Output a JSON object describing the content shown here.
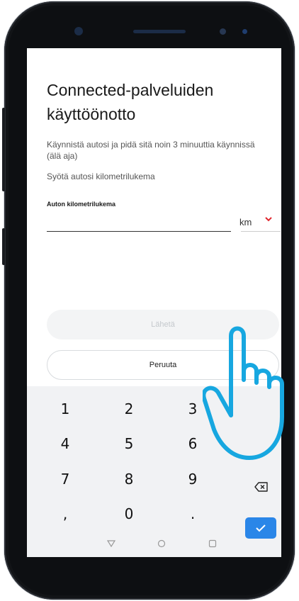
{
  "screen": {
    "title": "Connected-palveluiden käyttöönotto",
    "instruction_1": "Käynnistä autosi ja pidä sitä noin 3 minuuttia käynnissä (älä aja)",
    "instruction_2": "Syötä autosi kilometrilukema",
    "field_label": "Auton kilometrilukema",
    "field_value": "",
    "unit": "km",
    "submit_label": "Lähetä",
    "cancel_label": "Peruuta"
  },
  "keyboard": {
    "keys": [
      "1",
      "2",
      "3",
      "4",
      "5",
      "6",
      "7",
      "8",
      "9",
      ",",
      "0",
      "."
    ]
  },
  "colors": {
    "accent_red": "#e0262d",
    "keyboard_blue": "#2a86e8",
    "hand_outline": "#17a7e0"
  },
  "icons": [
    "chevron-down-icon",
    "backspace-icon",
    "checkmark-icon",
    "nav-back-icon",
    "nav-home-icon",
    "nav-recents-icon",
    "hand-pointer-icon"
  ]
}
